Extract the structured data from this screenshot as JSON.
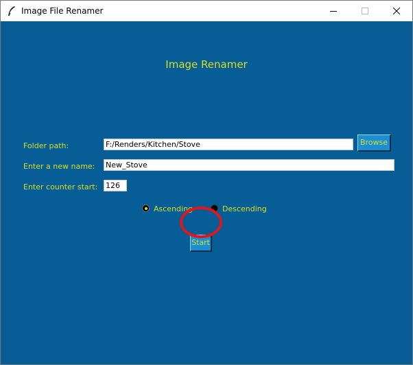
{
  "window": {
    "title": "Image File Renamer",
    "app_icon": "feather-icon",
    "controls": [
      "minimize-icon",
      "maximize-icon",
      "close-icon"
    ]
  },
  "heading": "Image Renamer",
  "form": {
    "folder_path_label": "Folder path:",
    "folder_path_value": "F:/Renders/Kitchen/Stove",
    "browse_label": "Browse",
    "new_name_label": "Enter a new name:",
    "new_name_value": "New_Stove",
    "counter_label": "Enter counter start:",
    "counter_value": "126"
  },
  "order": {
    "ascending_label": "Ascending",
    "descending_label": "Descending",
    "selected": "Ascending"
  },
  "start_label": "Start",
  "colors": {
    "background": "#075e97",
    "text_accent": "#d8df21",
    "button": "#1a8fd6",
    "highlight": "#e0161c"
  }
}
